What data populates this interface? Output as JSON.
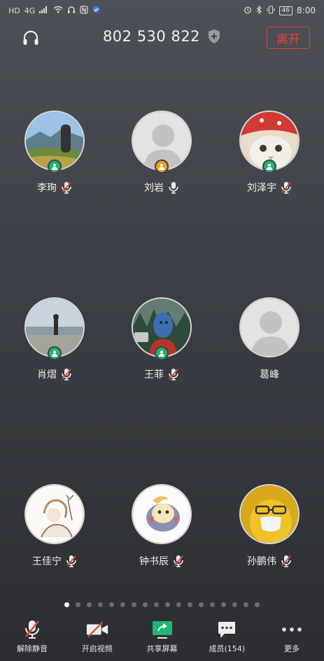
{
  "status_bar": {
    "left_icons": [
      "hd-icon",
      "signal-icon",
      "wifi-icon",
      "headset-status-icon",
      "nfc-icon",
      "check-icon"
    ],
    "network": "4G",
    "hd": "HD",
    "battery": "46",
    "time": "8:00"
  },
  "header": {
    "meeting_id": "802 530 822",
    "leave_label": "离开"
  },
  "participants": [
    {
      "name": "李珣",
      "badge": "green",
      "mic": "muted",
      "avatar": "landscape"
    },
    {
      "name": "刘岩",
      "badge": "orange",
      "mic": "on",
      "avatar": "default"
    },
    {
      "name": "刘泽宇",
      "badge": "green",
      "mic": "muted",
      "avatar": "cat"
    },
    {
      "name": "肖熠",
      "badge": "green",
      "mic": "muted",
      "avatar": "beach"
    },
    {
      "name": "王菲",
      "badge": "green",
      "mic": "muted",
      "avatar": "forest"
    },
    {
      "name": "葛峰",
      "badge": "none",
      "mic": "none",
      "avatar": "default"
    },
    {
      "name": "王佳宁",
      "badge": "none",
      "mic": "muted",
      "avatar": "sketch"
    },
    {
      "name": "钟书辰",
      "badge": "none",
      "mic": "muted",
      "avatar": "cartoon"
    },
    {
      "name": "孙鹏伟",
      "badge": "none",
      "mic": "muted",
      "avatar": "yellow"
    }
  ],
  "pager": {
    "total": 18,
    "active": 1
  },
  "toolbar": {
    "unmute": "解除静音",
    "video": "开启视频",
    "share": "共享屏幕",
    "members": "成员(154)",
    "more": "更多"
  },
  "colors": {
    "leave_red": "#e0443e",
    "badge_green": "#21b36b",
    "badge_orange": "#f0a020",
    "muted_red": "#e0443e"
  }
}
